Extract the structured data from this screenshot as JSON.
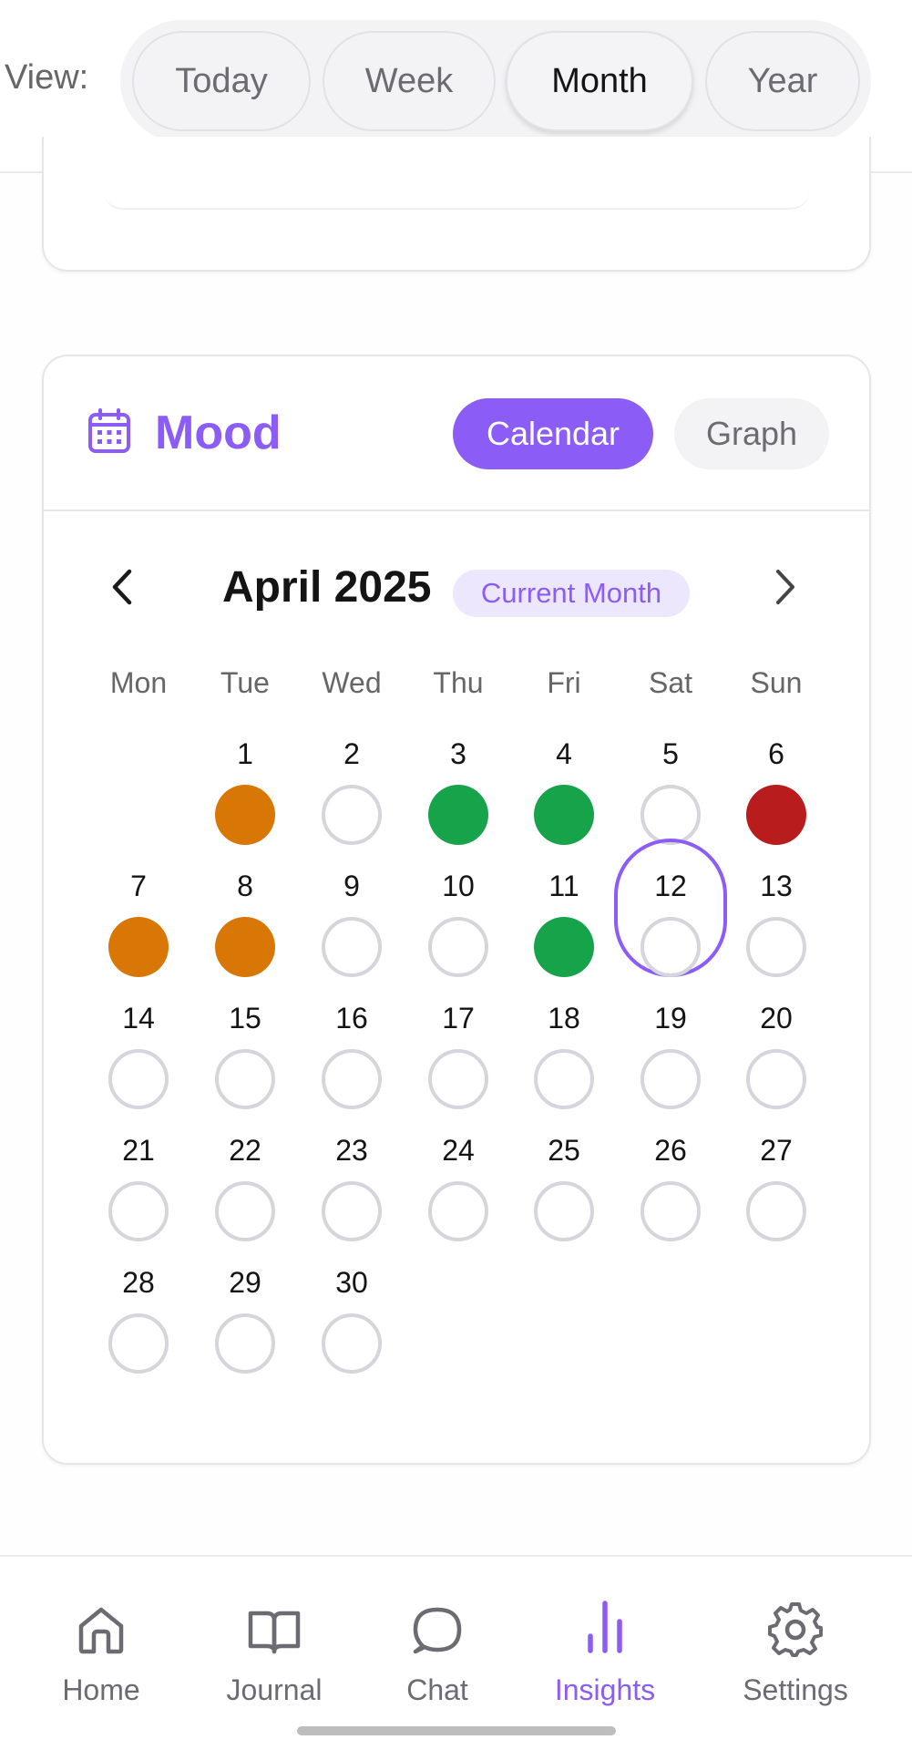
{
  "view_selector": {
    "label": "View:",
    "options": [
      "Today",
      "Week",
      "Month",
      "Year"
    ],
    "selected": "Month"
  },
  "mood": {
    "title": "Mood",
    "icon": "calendar-icon",
    "toggles": {
      "calendar": "Calendar",
      "graph": "Graph"
    },
    "active_toggle": "Calendar",
    "month_label": "April 2025",
    "badge": "Current Month",
    "weekdays": [
      "Mon",
      "Tue",
      "Wed",
      "Thu",
      "Fri",
      "Sat",
      "Sun"
    ],
    "first_weekday_index": 1,
    "days_in_month": 30,
    "today": 12,
    "mood_colors": {
      "orange": "#d97706",
      "green": "#16a34a",
      "red": "#b91c1c"
    },
    "moods": {
      "1": "orange",
      "3": "green",
      "4": "green",
      "6": "red",
      "7": "orange",
      "8": "orange",
      "11": "green"
    }
  },
  "bottom_nav": {
    "items": [
      {
        "label": "Home",
        "icon": "home-icon"
      },
      {
        "label": "Journal",
        "icon": "book-icon"
      },
      {
        "label": "Chat",
        "icon": "chat-bubble-icon"
      },
      {
        "label": "Insights",
        "icon": "insights-icon"
      },
      {
        "label": "Settings",
        "icon": "gear-icon"
      }
    ],
    "active": "Insights"
  },
  "accent_color": "#8b5cf6"
}
